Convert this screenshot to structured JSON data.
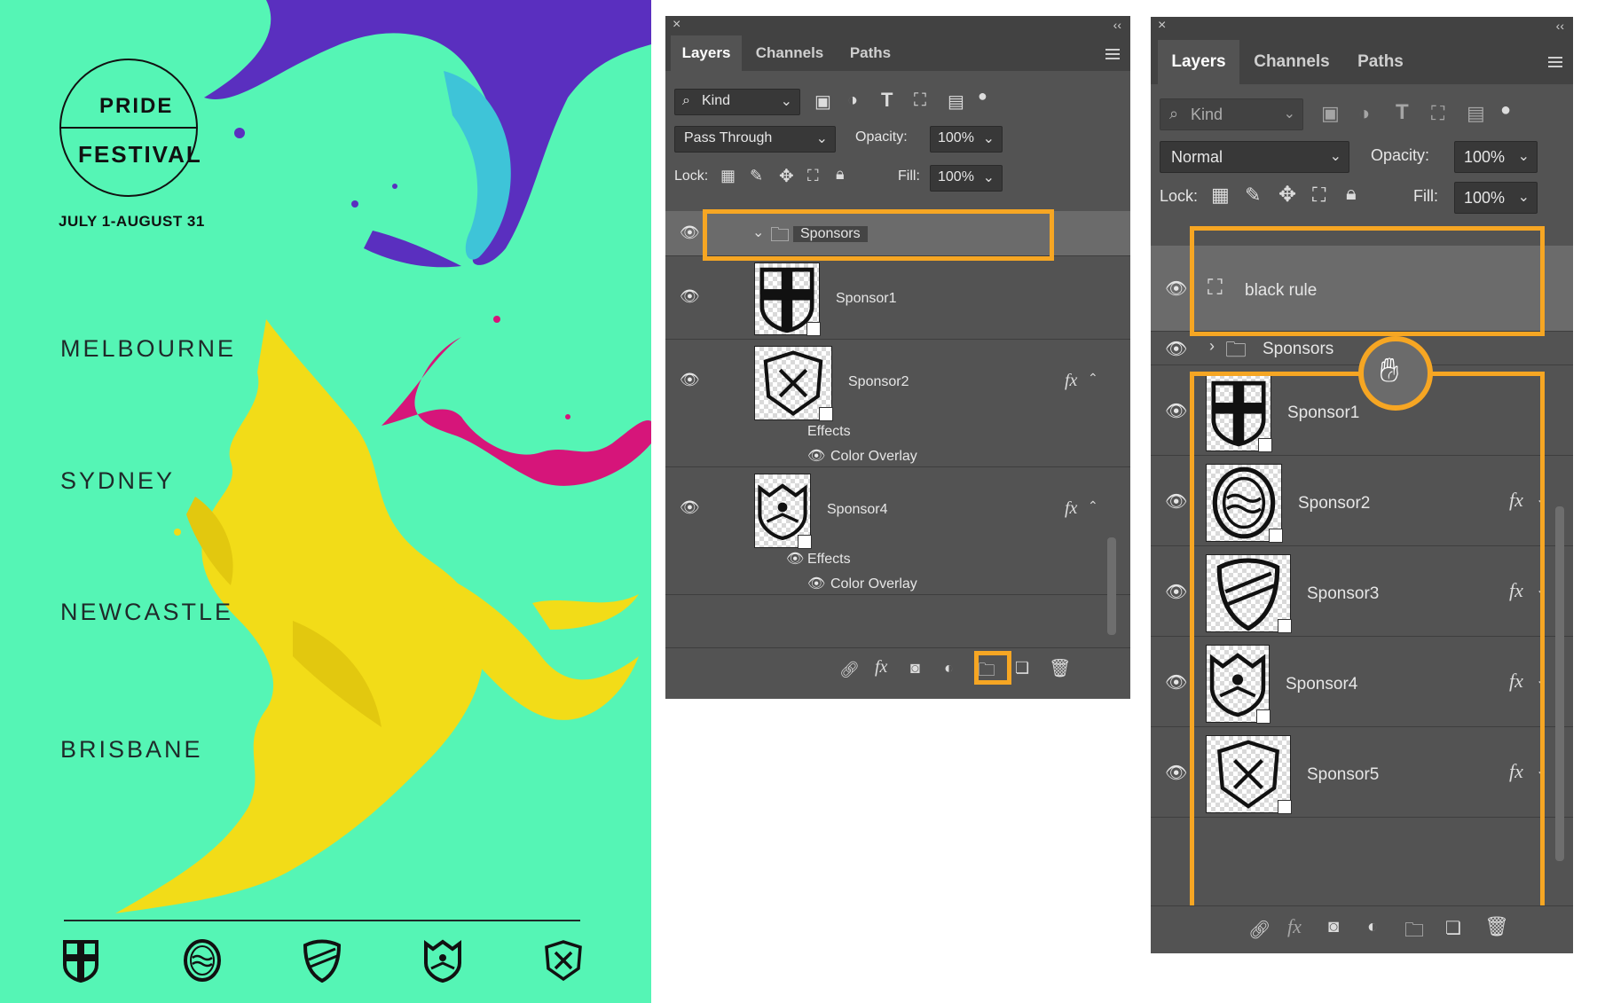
{
  "poster": {
    "logo_top": "PRIDE",
    "logo_bottom": "FESTIVAL",
    "dates": "JULY 1-AUGUST 31",
    "cities": [
      "MELBOURNE",
      "SYDNEY",
      "NEWCASTLE",
      "BRISBANE"
    ],
    "sponsor_icons": [
      "cross-shield-icon",
      "wave-circle-icon",
      "striped-shield-icon",
      "crest-shield-icon",
      "x-shield-icon"
    ],
    "colors": {
      "background": "#55f5b5",
      "yellow": "#f2dc18",
      "purple": "#5a2fbf",
      "magenta": "#d6157a",
      "teal": "#3ec4d8"
    }
  },
  "panel_left": {
    "tabs": [
      "Layers",
      "Channels",
      "Paths"
    ],
    "filter": "Kind",
    "blend_mode": "Pass Through",
    "opacity_label": "Opacity:",
    "opacity": "100%",
    "lock_label": "Lock:",
    "fill_label": "Fill:",
    "fill": "100%",
    "group_name": "Sponsors",
    "layers": [
      {
        "name": "Sponsor1"
      },
      {
        "name": "Sponsor2",
        "fx": "fx",
        "effects": "Effects",
        "effect_item": "Color Overlay"
      },
      {
        "name": "Sponsor4",
        "fx": "fx",
        "effects": "Effects",
        "effect_item": "Color Overlay"
      }
    ]
  },
  "panel_right": {
    "tabs": [
      "Layers",
      "Channels",
      "Paths"
    ],
    "filter": "Kind",
    "blend_mode": "Normal",
    "opacity_label": "Opacity:",
    "opacity": "100%",
    "lock_label": "Lock:",
    "fill_label": "Fill:",
    "fill": "100%",
    "top_layer": "black rule",
    "group_name": "Sponsors",
    "layers": [
      {
        "name": "Sponsor1"
      },
      {
        "name": "Sponsor2",
        "fx": "fx"
      },
      {
        "name": "Sponsor3",
        "fx": "fx"
      },
      {
        "name": "Sponsor4",
        "fx": "fx"
      },
      {
        "name": "Sponsor5",
        "fx": "fx"
      }
    ]
  },
  "highlight_color": "#f6a623"
}
